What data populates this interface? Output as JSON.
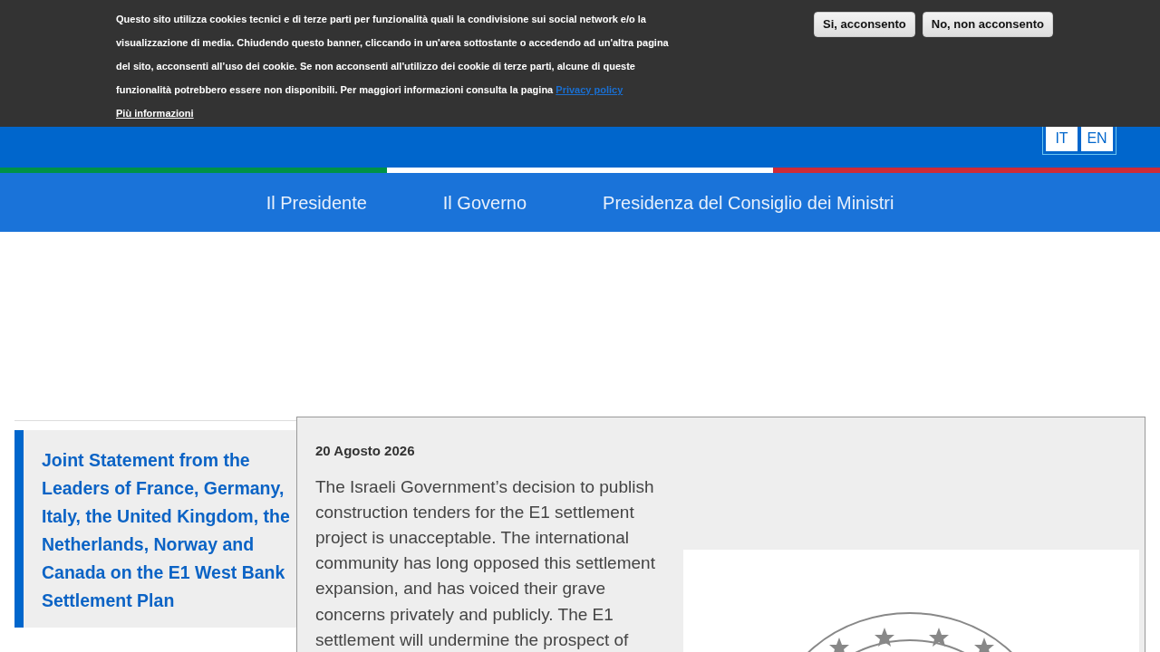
{
  "cookie_banner": {
    "text": "Questo sito utilizza cookies tecnici e di terze parti per funzionalità quali la condivisione sui social network e/o la visualizzazione di media. Chiudendo questo banner, cliccando in un'area sottostante o accedendo ad un'altra pagina del sito, acconsenti all’uso dei cookie. Se non acconsenti all'utilizzo dei cookie di terze parti, alcune di queste funzionalità potrebbero essere non disponibili. Per maggiori informazioni consulta la pagina",
    "link": "Privacy policy",
    "more": "Più informazioni",
    "buttons": [
      "Si, acconsento",
      "No, non acconsento"
    ]
  },
  "languages": [
    "IT",
    "EN"
  ],
  "nav": [
    "Il Presidente",
    "Il Governo",
    "Presidenza del Consiglio dei Ministri"
  ],
  "sidebar": {
    "items": [
      {
        "title": "Joint Statement from the Leaders of France, Germany, Italy, the United Kingdom, the Netherlands, Norway and Canada on the E1 West Bank Settlement Plan",
        "selected": true
      }
    ]
  },
  "article": {
    "date": "20 Agosto 2026",
    "body": "The Israeli Government’s decision to publish construction tenders for the E1 settlement project is unacceptable. The international community has long opposed this settlement expansion, and has voiced their grave concerns privately and publicly. The E1 settlement will undermine the prospect of"
  }
}
